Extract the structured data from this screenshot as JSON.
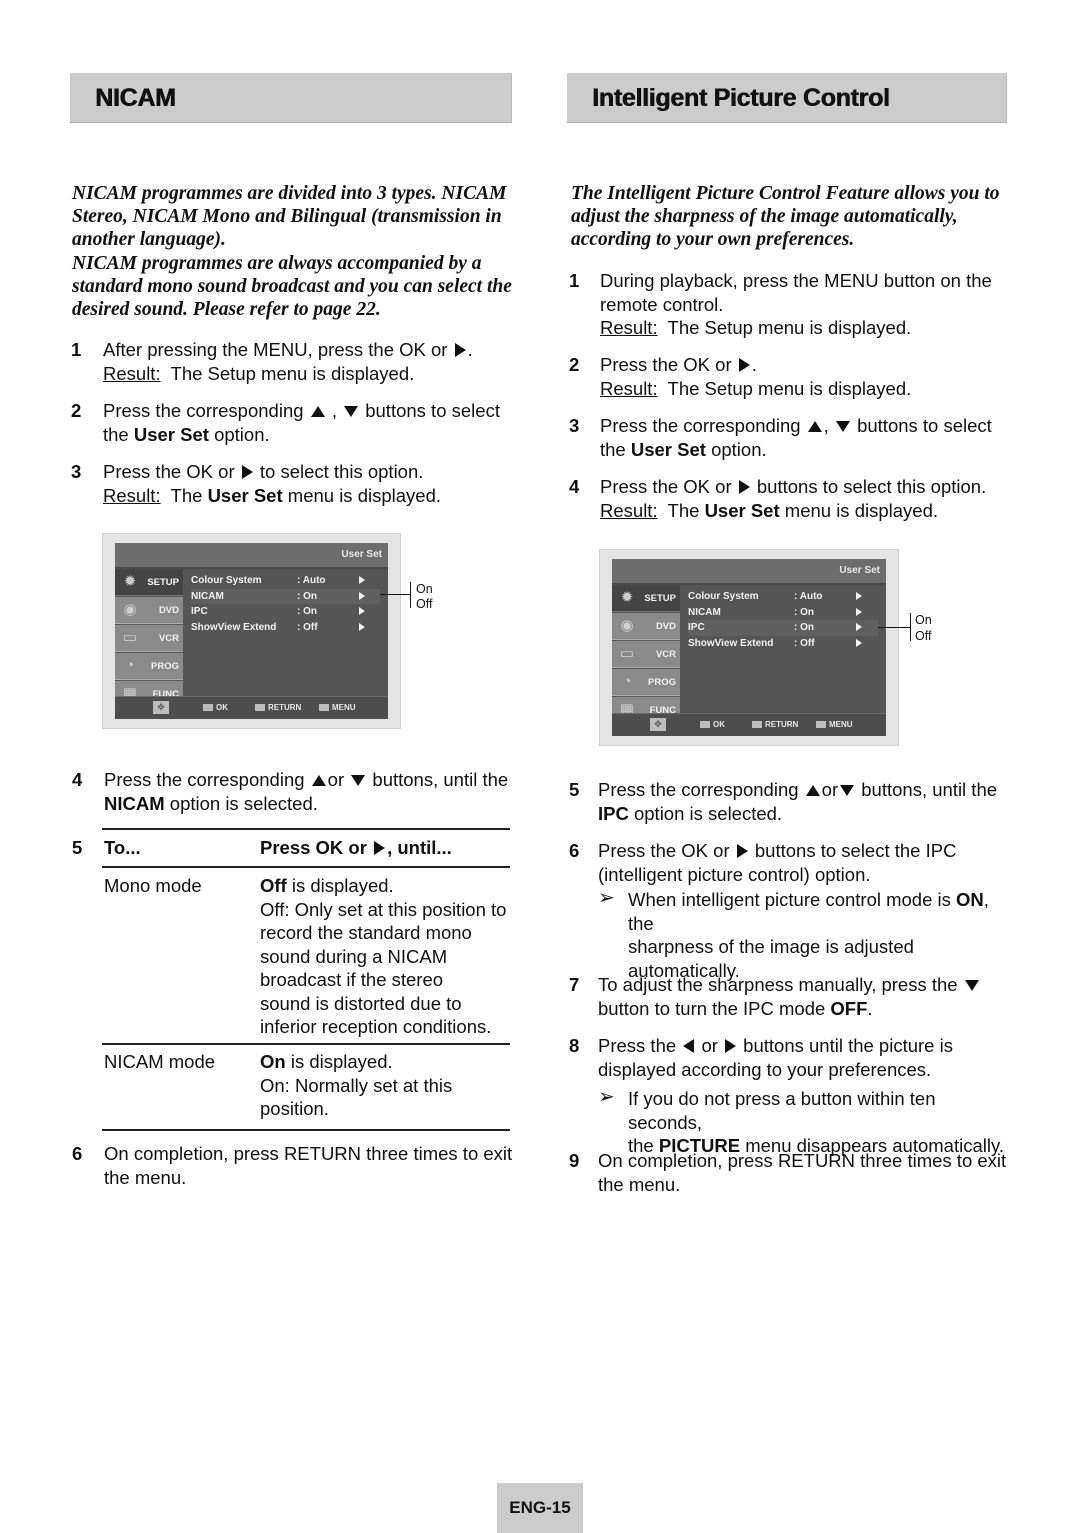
{
  "left": {
    "title": "NICAM",
    "intro": [
      "NICAM programmes are divided into 3 types. NICAM",
      "Stereo, NICAM Mono and Bilingual (transmission in",
      "another language).",
      "NICAM programmes are always accompanied by a",
      "standard mono sound broadcast and you can select the",
      "desired sound. Please refer to page 22."
    ],
    "steps": [
      {
        "num": "1",
        "text_a": "After pressing the MENU, press the OK or",
        "text_b": ".",
        "result_label": "Result:",
        "result_text": "The Setup menu is displayed."
      },
      {
        "num": "2",
        "text_a": "Press the corresponding",
        "text_b": ",",
        "text_c": "buttons to select",
        "line2_a": "the",
        "line2_bold": "User Set",
        "line2_b": "option."
      },
      {
        "num": "3",
        "text_a": "Press the OK or",
        "text_b": "to select this option.",
        "result_label": "Result:",
        "result_a": "The",
        "result_bold": "User Set",
        "result_b": "menu is displayed."
      },
      {
        "num": "4",
        "text_a": "Press the corresponding",
        "text_b": "or",
        "text_c": "buttons, until the",
        "line2_bold": "NICAM",
        "line2_b": "option is selected."
      },
      {
        "num": "5"
      },
      {
        "num": "6",
        "text": "On completion, press RETURN three times to exit",
        "text2": "the menu."
      }
    ],
    "table": {
      "header_col1": "To...",
      "header_col2_a": "Press OK or",
      "header_col2_b": ", until...",
      "rows": [
        {
          "mode": "Mono mode",
          "bold": "Off",
          "first": "is displayed.",
          "lines": [
            "Off: Only set at this position to",
            "record the standard mono",
            "sound during a NICAM",
            "broadcast if the stereo",
            "sound is distorted due to",
            "inferior reception conditions."
          ]
        },
        {
          "mode": "NICAM mode",
          "bold": "On",
          "first": "is displayed.",
          "lines": [
            "On: Normally set at this",
            "position."
          ]
        }
      ]
    }
  },
  "right": {
    "title": "Intelligent Picture Control",
    "intro": [
      "The Intelligent Picture Control Feature allows you to",
      "adjust the sharpness of the image automatically,",
      "according to your own preferences."
    ],
    "steps": [
      {
        "num": "1",
        "text": "During playback, press the MENU button on the",
        "text2": "remote control.",
        "result_label": "Result:",
        "result_text": "The Setup menu is displayed."
      },
      {
        "num": "2",
        "text_a": "Press the OK or",
        "text_b": ".",
        "result_label": "Result:",
        "result_text": "The Setup menu is displayed."
      },
      {
        "num": "3",
        "text_a": "Press the corresponding",
        "text_b": ",",
        "text_c": "buttons to select",
        "line2_a": "the",
        "line2_bold": "User Set",
        "line2_b": "option."
      },
      {
        "num": "4",
        "text_a": "Press the OK or",
        "text_b": "buttons to select this option.",
        "result_label": "Result:",
        "result_a": "The",
        "result_bold": "User Set",
        "result_b": "menu is displayed."
      },
      {
        "num": "5",
        "text_a": "Press the corresponding",
        "text_b": "or",
        "text_c": "buttons, until the",
        "line2_bold": "IPC",
        "line2_b": "option is selected."
      },
      {
        "num": "6",
        "text_a": "Press the OK or",
        "text_b": "buttons to select the IPC",
        "text2": "(intelligent picture control) option.",
        "note_a": "When intelligent picture control mode is",
        "note_bold": "ON",
        "note_b": ", the",
        "note2": "sharpness of the image is adjusted",
        "note3": "automatically."
      },
      {
        "num": "7",
        "text_a": "To adjust the sharpness manually, press the",
        "line2_a": "button to turn the IPC mode",
        "line2_bold": "OFF",
        "line2_b": "."
      },
      {
        "num": "8",
        "text_a": "Press the",
        "text_b": "or",
        "text_c": "buttons until the picture is",
        "text2": "displayed according to your preferences.",
        "note_a": "If you do not press a button within ten seconds,",
        "note2_a": "the",
        "note2_bold": "PICTURE",
        "note2_b": "menu disappears automatically."
      },
      {
        "num": "9",
        "text": "On completion, press RETURN three times to exit",
        "text2": "the menu."
      }
    ]
  },
  "osd": {
    "title": "User Set",
    "tabs": [
      "SETUP",
      "DVD",
      "VCR",
      "PROG",
      "FUNC"
    ],
    "rows": [
      {
        "label": "Colour  System",
        "value": ": Auto"
      },
      {
        "label": "NICAM",
        "value": ": On"
      },
      {
        "label": "IPC",
        "value": ": On"
      },
      {
        "label": "ShowView Extend",
        "value": ": Off"
      }
    ],
    "footer": {
      "ok": "OK",
      "return": "RETURN",
      "menu": "MENU"
    },
    "callout": {
      "on": "On",
      "off": "Off"
    },
    "left_selected_row": "NICAM",
    "right_selected_row": "IPC"
  },
  "page_number": "ENG-15"
}
